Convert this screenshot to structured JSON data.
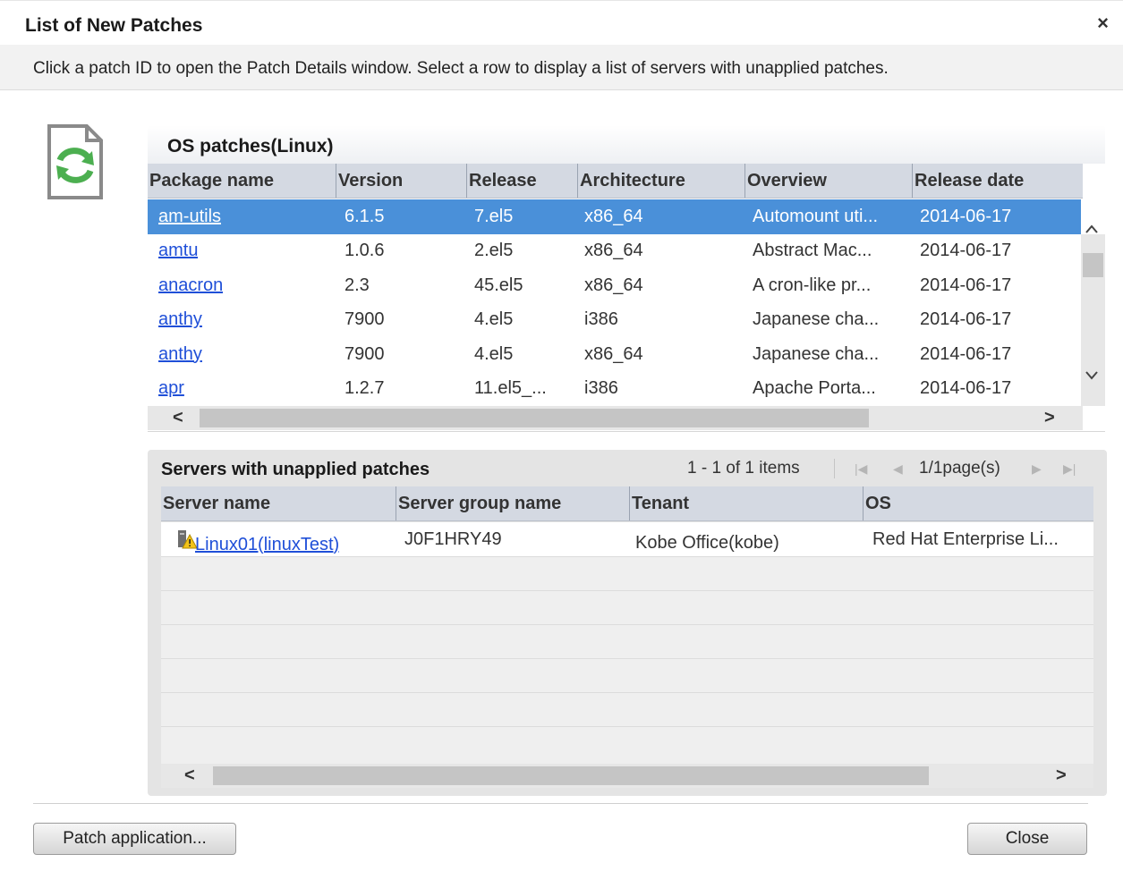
{
  "dialog": {
    "title": "List of New Patches",
    "close_glyph": "×",
    "instruction": "Click a patch ID to open the Patch Details window. Select a row to display a list of servers with unapplied patches."
  },
  "icons": {
    "document": "patch-document-icon",
    "refresh": "refresh-arrows-icon",
    "warning": "warning-icon",
    "server": "server-icon"
  },
  "colors": {
    "selected_row": "#4a90d9",
    "link": "#1f4fd8",
    "header": "#d4d9e2",
    "icon_green": "#4caf50"
  },
  "patches": {
    "title": "OS patches(Linux)",
    "columns": [
      "Package name",
      "Version",
      "Release",
      "Architecture",
      "Overview",
      "Release date"
    ],
    "selected_index": 0,
    "rows": [
      {
        "package": "am-utils",
        "version": "6.1.5",
        "release": "7.el5",
        "arch": "x86_64",
        "overview": "Automount uti...",
        "date": "2014-06-17"
      },
      {
        "package": "amtu",
        "version": "1.0.6",
        "release": "2.el5",
        "arch": "x86_64",
        "overview": "Abstract Mac...",
        "date": "2014-06-17"
      },
      {
        "package": "anacron",
        "version": "2.3",
        "release": "45.el5",
        "arch": "x86_64",
        "overview": "A cron-like pr...",
        "date": "2014-06-17"
      },
      {
        "package": "anthy",
        "version": "7900",
        "release": "4.el5",
        "arch": "i386",
        "overview": "Japanese cha...",
        "date": "2014-06-17"
      },
      {
        "package": "anthy",
        "version": "7900",
        "release": "4.el5",
        "arch": "x86_64",
        "overview": "Japanese cha...",
        "date": "2014-06-17"
      },
      {
        "package": "apr",
        "version": "1.2.7",
        "release": "11.el5_...",
        "arch": "i386",
        "overview": "Apache Porta...",
        "date": "2014-06-17"
      }
    ],
    "scroll_left": "<",
    "scroll_right": ">",
    "scroll_up": "^",
    "scroll_down": "v"
  },
  "servers": {
    "title": "Servers with unapplied patches",
    "pager_range": "1 - 1 of 1 items",
    "pager_page": "1/1page(s)",
    "columns": [
      "Server name",
      "Server group name",
      "Tenant",
      "OS"
    ],
    "rows": [
      {
        "server": "Linux01(linuxTest)",
        "group": "J0F1HRY49",
        "tenant": "Kobe Office(kobe)",
        "os": "Red Hat Enterprise Li..."
      }
    ],
    "scroll_left": "<",
    "scroll_right": ">"
  },
  "buttons": {
    "patch_application": "Patch application...",
    "close": "Close"
  }
}
